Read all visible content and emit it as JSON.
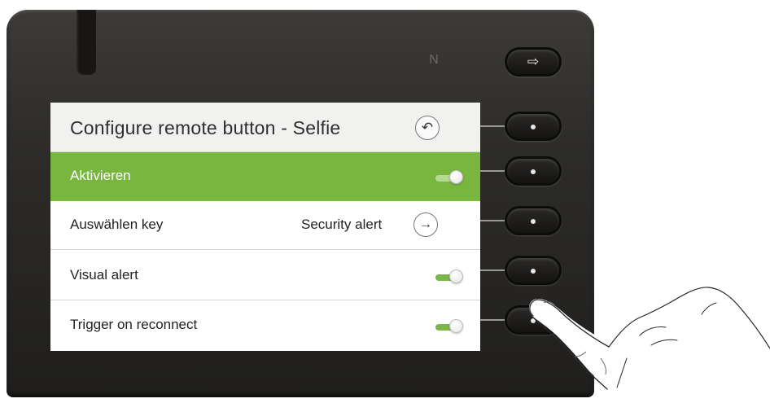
{
  "nfc_symbol": "N",
  "exit_icon": "⇨",
  "screen": {
    "title": "Configure remote button - Selfie",
    "back_icon": "↶",
    "rows": [
      {
        "label": "Aktivieren",
        "value": "",
        "control": "toggle",
        "state": "on",
        "selected": true
      },
      {
        "label": "Auswählen key",
        "value": "Security alert",
        "control": "arrow",
        "arrow_icon": "→"
      },
      {
        "label": "Visual alert",
        "value": "",
        "control": "toggle",
        "state": "on"
      },
      {
        "label": "Trigger on reconnect",
        "value": "",
        "control": "toggle",
        "state": "on"
      }
    ]
  },
  "colors": {
    "accent": "#78b640",
    "device": "#2d2c2a",
    "toggle": "#7ab648"
  }
}
